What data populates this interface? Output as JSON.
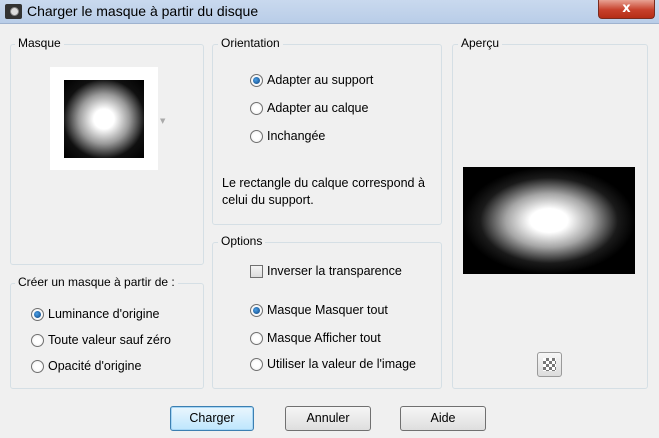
{
  "window": {
    "title": "Charger le masque à partir du disque",
    "close_label": "x"
  },
  "masque": {
    "label": "Masque"
  },
  "orientation": {
    "label": "Orientation",
    "options": [
      {
        "label": "Adapter au support",
        "checked": true
      },
      {
        "label": "Adapter au calque",
        "checked": false
      },
      {
        "label": "Inchangée",
        "checked": false
      }
    ],
    "info": "Le rectangle du calque correspond à celui du support."
  },
  "apercu": {
    "label": "Aperçu"
  },
  "create_from": {
    "label": "Créer un masque à partir de :",
    "options": [
      {
        "label": "Luminance d'origine",
        "checked": true
      },
      {
        "label": "Toute valeur sauf zéro",
        "checked": false
      },
      {
        "label": "Opacité d'origine",
        "checked": false
      }
    ]
  },
  "options": {
    "label": "Options",
    "invert_label": "Inverser la transparence",
    "invert_checked": false,
    "radios": [
      {
        "label": "Masque Masquer tout",
        "checked": true
      },
      {
        "label": "Masque Afficher tout",
        "checked": false
      },
      {
        "label": "Utiliser la valeur de l'image",
        "checked": false
      }
    ]
  },
  "buttons": {
    "load": "Charger",
    "cancel": "Annuler",
    "help": "Aide"
  }
}
